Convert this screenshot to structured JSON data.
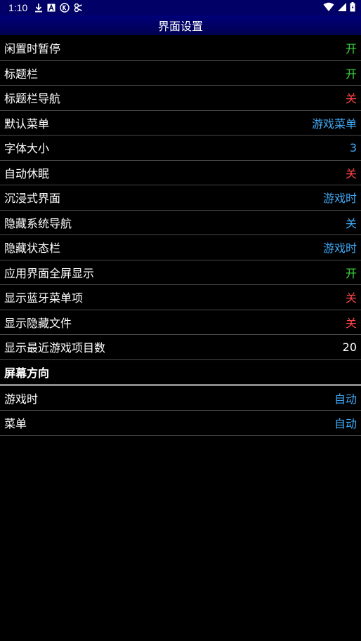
{
  "status_bar": {
    "time": "1:10",
    "left_icons": [
      "download-icon",
      "text-a-icon",
      "k-circle-icon",
      "link-icon"
    ],
    "right_icons": [
      "wifi-icon",
      "signal-icon",
      "battery-icon"
    ]
  },
  "title_bar": {
    "title": "界面设置"
  },
  "settings": [
    {
      "label": "闲置时暂停",
      "value": "开",
      "color": "#3dd63d"
    },
    {
      "label": "标题栏",
      "value": "开",
      "color": "#3dd63d"
    },
    {
      "label": "标题栏导航",
      "value": "关",
      "color": "#ff4545"
    },
    {
      "label": "默认菜单",
      "value": "游戏菜单",
      "color": "#3fa9f5"
    },
    {
      "label": "字体大小",
      "value": "3",
      "color": "#3fa9f5"
    },
    {
      "label": "自动休眠",
      "value": "关",
      "color": "#ff4545"
    },
    {
      "label": "沉浸式界面",
      "value": "游戏时",
      "color": "#3fa9f5"
    },
    {
      "label": "隐藏系统导航",
      "value": "关",
      "color": "#3fa9f5"
    },
    {
      "label": "隐藏状态栏",
      "value": "游戏时",
      "color": "#3fa9f5"
    },
    {
      "label": "应用界面全屏显示",
      "value": "开",
      "color": "#3dd63d"
    },
    {
      "label": "显示蓝牙菜单项",
      "value": "关",
      "color": "#ff4545"
    },
    {
      "label": "显示隐藏文件",
      "value": "关",
      "color": "#ff4545"
    },
    {
      "label": "显示最近游戏项目数",
      "value": "20",
      "color": "#ffffff"
    }
  ],
  "screen_orientation": {
    "header": "屏幕方向",
    "items": [
      {
        "label": "游戏时",
        "value": "自动",
        "color": "#3fa9f5"
      },
      {
        "label": "菜单",
        "value": "自动",
        "color": "#3fa9f5"
      }
    ]
  }
}
